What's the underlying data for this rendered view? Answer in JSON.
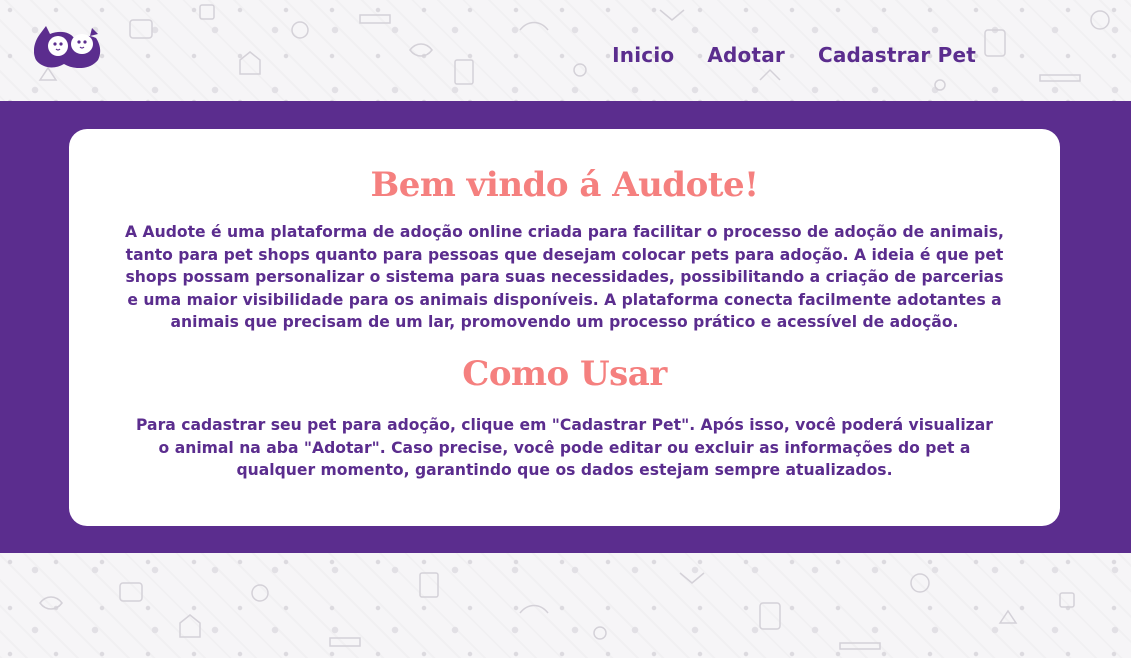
{
  "header": {
    "logo_icon": "cat-and-dog-logo-icon",
    "nav": [
      {
        "label": "Inicio"
      },
      {
        "label": "Adotar"
      },
      {
        "label": "Cadastrar Pet"
      }
    ]
  },
  "main": {
    "welcome_title": "Bem vindo á Audote!",
    "welcome_text": "A Audote é uma plataforma de adoção online criada para facilitar o processo de adoção de animais, tanto para pet shops quanto para pessoas que desejam colocar pets para adoção. A ideia é que pet shops possam personalizar o sistema para suas necessidades, possibilitando a criação de parcerias e uma maior visibilidade para os animais disponíveis. A plataforma conecta facilmente adotantes a animais que precisam de um lar, promovendo um processo prático e acessível de adoção.",
    "howto_title": "Como Usar",
    "howto_text": "Para cadastrar seu pet para adoção, clique em \"Cadastrar Pet\". Após isso, você poderá visualizar o animal na aba \"Adotar\". Caso precise, você pode editar ou excluir as informações do pet a qualquer momento, garantindo que os dados estejam sempre atualizados."
  },
  "colors": {
    "brand_purple": "#5b2d8e",
    "title_pink": "#f5807f",
    "card_bg": "#ffffff",
    "pattern_bg": "#f6f5f7"
  }
}
